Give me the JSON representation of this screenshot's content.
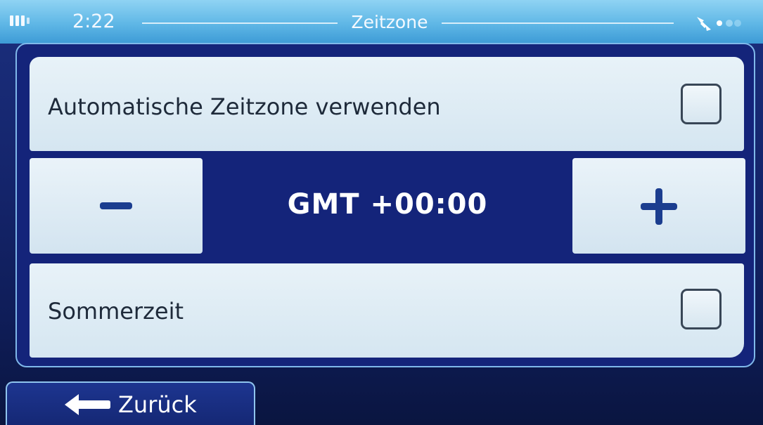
{
  "status_bar": {
    "time": "2:22",
    "title": "Zeitzone",
    "battery_icon": "battery-icon",
    "gps_icon": "satellite-no-signal-icon"
  },
  "settings": {
    "auto_timezone": {
      "label": "Automatische Zeitzone verwenden",
      "checked": false
    },
    "timezone": {
      "value": "GMT +00:00",
      "decrease_icon": "minus-icon",
      "increase_icon": "plus-icon"
    },
    "summer_time": {
      "label": "Sommerzeit",
      "checked": false
    }
  },
  "footer": {
    "back_label": "Zurück",
    "back_icon": "arrow-left-icon"
  },
  "colors": {
    "accent_blue": "#14247a",
    "row_background": "#e8f2f8",
    "status_bar": "#5fb7e6",
    "icon_blue": "#1b3d8f"
  }
}
